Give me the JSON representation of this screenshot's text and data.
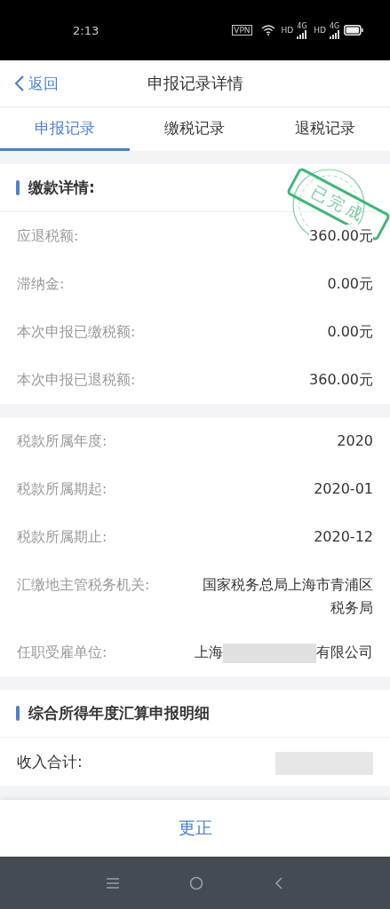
{
  "status_bar": {
    "time": "2:13",
    "vpn": "VPN",
    "signals": [
      {
        "hd": "HD",
        "network": "4G"
      },
      {
        "hd": "HD",
        "network": "4G"
      }
    ]
  },
  "header": {
    "back": "返回",
    "title": "申报记录详情"
  },
  "tabs": [
    {
      "label": "申报记录",
      "selected": true
    },
    {
      "label": "缴税记录",
      "selected": false
    },
    {
      "label": "退税记录",
      "selected": false
    }
  ],
  "payment_section": {
    "title": "缴款详情:",
    "stamp": "已完成",
    "rows": [
      {
        "label": "应退税额:",
        "value": "360.00元"
      },
      {
        "label": "滞纳金:",
        "value": "0.00元"
      },
      {
        "label": "本次申报已缴税额:",
        "value": "0.00元"
      },
      {
        "label": "本次申报已退税额:",
        "value": "360.00元"
      }
    ]
  },
  "period_rows": [
    {
      "label": "税款所属年度:",
      "value": "2020"
    },
    {
      "label": "税款所属期起:",
      "value": "2020-01"
    },
    {
      "label": "税款所属期止:",
      "value": "2020-12"
    },
    {
      "label": "汇缴地主管税务机关:",
      "value": "国家税务总局上海市青浦区税务局"
    },
    {
      "label": "任职受雇单位:",
      "value": "上海",
      "value_end": "有限公司",
      "redacted": true
    }
  ],
  "detail_section": {
    "title": "综合所得年度汇算申报明细",
    "rows": [
      {
        "label": "收入合计:",
        "redacted": true
      }
    ]
  },
  "footer_button": "更正"
}
